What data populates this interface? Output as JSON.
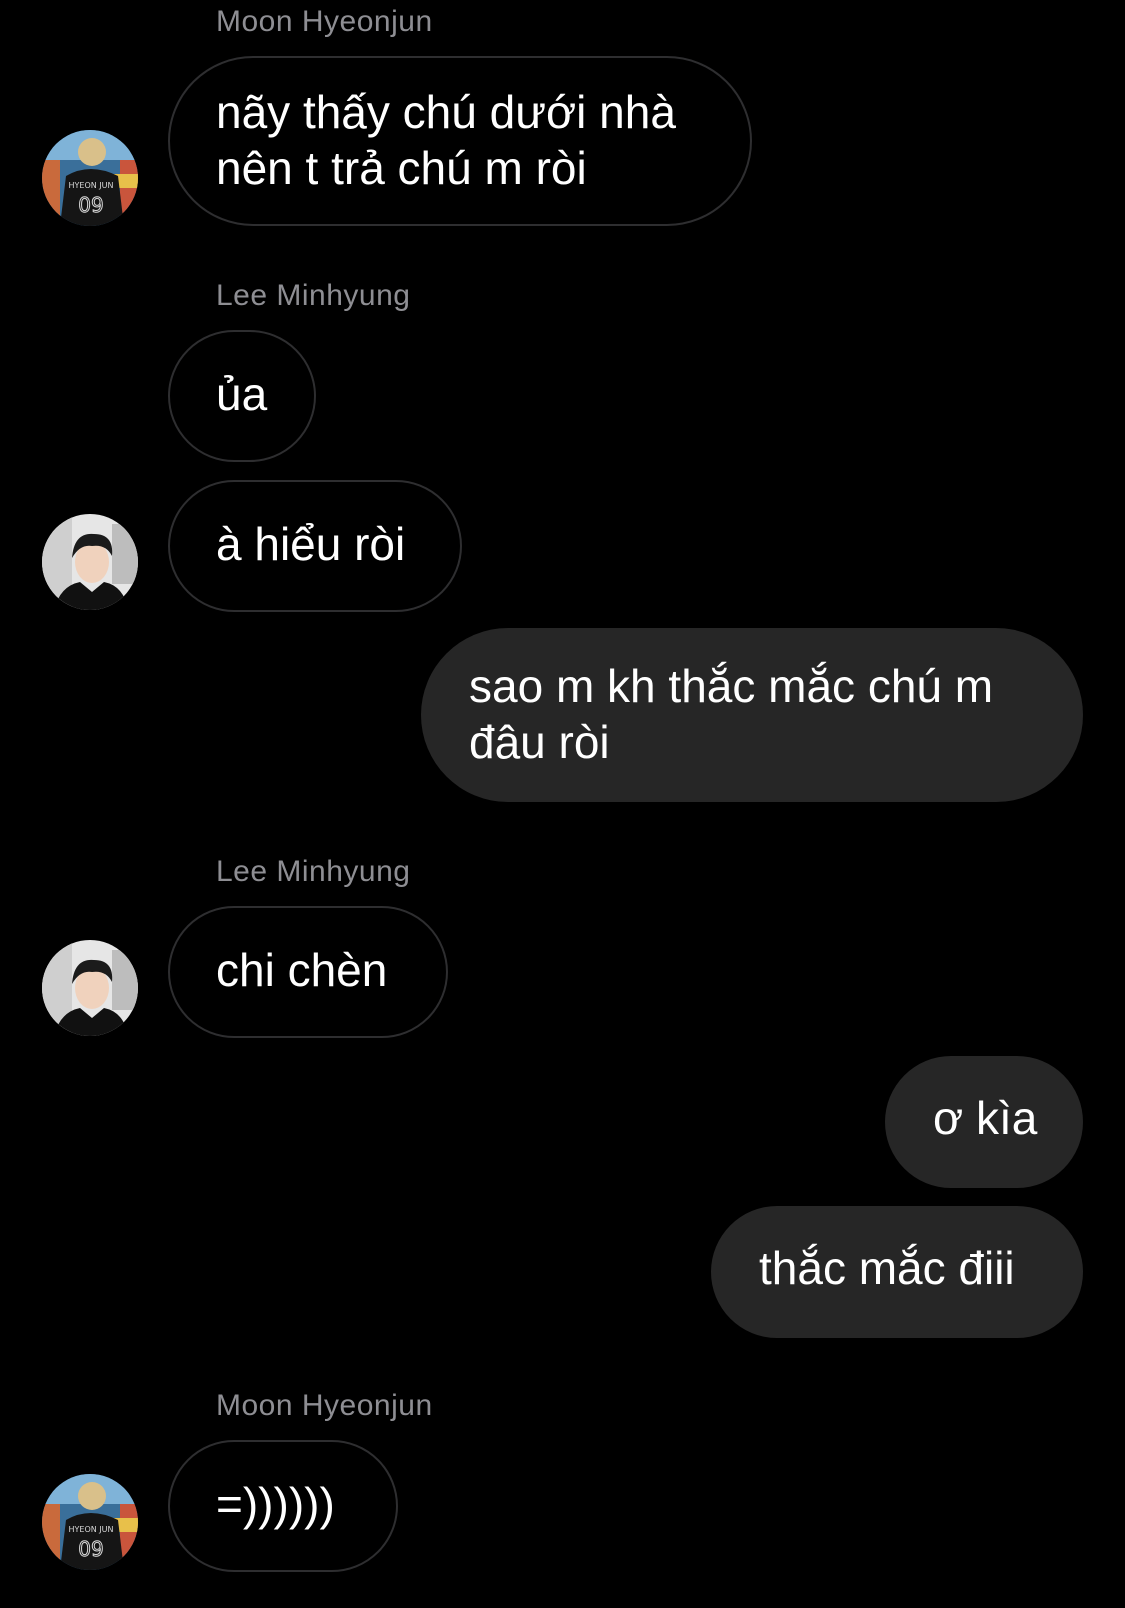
{
  "messages": [
    {
      "sender": "Moon Hyeonjun",
      "text": "nãy thấy chú dưới nhà\nnên t trả chú m ròi"
    },
    {
      "sender": "Lee Minhyung",
      "text": "ủa"
    },
    {
      "text": "à hiểu ròi"
    },
    {
      "text": "sao m kh thắc mắc chú m\nđâu ròi"
    },
    {
      "sender": "Lee Minhyung",
      "text": "chi chèn"
    },
    {
      "text": "ơ kìa"
    },
    {
      "text": "thắc mắc điii"
    },
    {
      "sender": "Moon Hyeonjun",
      "text": "=))))))"
    }
  ],
  "avatars": {
    "moon_hyeonjun": {
      "jersey_name": "HYEON JUN",
      "jersey_number": "09"
    }
  },
  "colors": {
    "background": "#000000",
    "outgoing_bubble": "#262626",
    "incoming_border": "#2e2e30",
    "sender_name": "#8e8e93",
    "text": "#ffffff"
  }
}
